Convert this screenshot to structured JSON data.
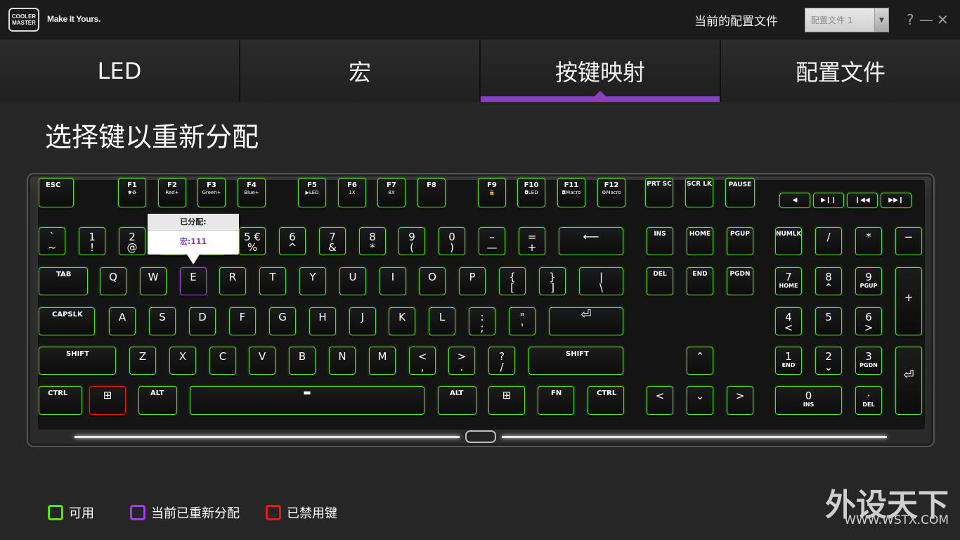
{
  "header": {
    "logo_line1": "COOLER",
    "logo_line2": "MASTER",
    "tagline": "Make It Yours.",
    "profile_label": "当前的配置文件",
    "profile_value": "配置文件 1",
    "help": "?",
    "minimize": "—",
    "close": "✕"
  },
  "tabs": [
    {
      "label": "LED",
      "active": false
    },
    {
      "label": "宏",
      "active": false
    },
    {
      "label": "按键映射",
      "active": true
    },
    {
      "label": "配置文件",
      "active": false
    }
  ],
  "page_title": "选择键以重新分配",
  "tooltip": {
    "title": "已分配:",
    "value": "宏:111"
  },
  "keys": {
    "esc": "ESC",
    "f": [
      {
        "k": "F1",
        "s": "✱♻"
      },
      {
        "k": "F2",
        "s": "Red+"
      },
      {
        "k": "F3",
        "s": "Green+"
      },
      {
        "k": "F4",
        "s": "Blue+"
      },
      {
        "k": "F5",
        "s": "▶LED"
      },
      {
        "k": "F6",
        "s": "1X"
      },
      {
        "k": "F7",
        "s": "8X"
      },
      {
        "k": "F8",
        "s": ""
      },
      {
        "k": "F9",
        "s": "🔒"
      },
      {
        "k": "F10",
        "s": "◘LED"
      },
      {
        "k": "F11",
        "s": "◘Macro"
      },
      {
        "k": "F12",
        "s": "⚙Macro"
      }
    ],
    "prtsc": "PRT SC",
    "scrlk": "SCR LK",
    "pause": "PAUSE",
    "media": [
      "◀",
      "▶❙❙",
      "❙◀◀",
      "▶▶❙"
    ],
    "num_row": [
      {
        "a": "`",
        "b": "~"
      },
      {
        "a": "1",
        "b": "!"
      },
      {
        "a": "2",
        "b": "@"
      },
      {
        "a": "5 €",
        "b": "%"
      },
      {
        "a": "6",
        "b": "^"
      },
      {
        "a": "7",
        "b": "&"
      },
      {
        "a": "8",
        "b": "*"
      },
      {
        "a": "9",
        "b": "("
      },
      {
        "a": "0",
        "b": ")"
      },
      {
        "a": "–",
        "b": "—"
      },
      {
        "a": "=",
        "b": "+"
      }
    ],
    "backspace": "⟵",
    "ins": "INS",
    "home": "HOME",
    "pgup": "PGUP",
    "numlk": "NUMLK",
    "slash": "/",
    "star": "*",
    "minus": "−",
    "tab": "TAB",
    "qrow": [
      "Q",
      "W",
      "E",
      "R",
      "T",
      "Y",
      "U",
      "I",
      "O",
      "P"
    ],
    "bracket_l": {
      "a": "{",
      "b": "["
    },
    "bracket_r": {
      "a": "}",
      "b": "]"
    },
    "backslash": {
      "a": "|",
      "b": "\\"
    },
    "del": "DEL",
    "end": "END",
    "pgdn": "PGDN",
    "n7": {
      "a": "7",
      "b": "HOME"
    },
    "n8": {
      "a": "8",
      "b": "⌃"
    },
    "n9": {
      "a": "9",
      "b": "PGUP"
    },
    "plus": "+",
    "caps": "CAPSLK",
    "arow": [
      "A",
      "S",
      "D",
      "F",
      "G",
      "H",
      "J",
      "K",
      "L"
    ],
    "semi": {
      "a": ":",
      "b": ";"
    },
    "quote": {
      "a": "\"",
      "b": "'"
    },
    "enter": "⏎",
    "n4": {
      "a": "4",
      "b": "<"
    },
    "n5": "5",
    "n6": {
      "a": "6",
      "b": ">"
    },
    "lshift": "SHIFT",
    "zrow": [
      "Z",
      "X",
      "C",
      "V",
      "B",
      "N",
      "M"
    ],
    "comma": {
      "a": "<",
      "b": ","
    },
    "period": {
      "a": ">",
      "b": "."
    },
    "qmark": {
      "a": "?",
      "b": "/"
    },
    "rshift": "SHIFT",
    "up": "⌃",
    "n1": {
      "a": "1",
      "b": "END"
    },
    "n2": {
      "a": "2",
      "b": "⌄"
    },
    "n3": {
      "a": "3",
      "b": "PGDN"
    },
    "nenter": "⏎",
    "lctrl": "CTRL",
    "lwin": "⊞",
    "lalt": "ALT",
    "space": "▬",
    "ralt": "ALT",
    "rwin": "⊞",
    "fn": "FN",
    "rctrl": "CTRL",
    "left": "<",
    "down": "⌄",
    "right": ">",
    "n0": {
      "a": "0",
      "b": "INS"
    },
    "ndot": {
      "a": "·",
      "b": "DEL"
    }
  },
  "legend": [
    {
      "label": "可用",
      "color": "#5ae01e"
    },
    {
      "label": "当前已重新分配",
      "color": "#a13fe0"
    },
    {
      "label": "已禁用键",
      "color": "#e21b1b"
    }
  ],
  "watermark": {
    "cn": "外设天下",
    "url": "WWW.WSTX.COM"
  },
  "colors": {
    "accent": "#8e3cc0",
    "available": "#5ae01e",
    "remapped": "#a13fe0",
    "disabled": "#e21b1b"
  }
}
